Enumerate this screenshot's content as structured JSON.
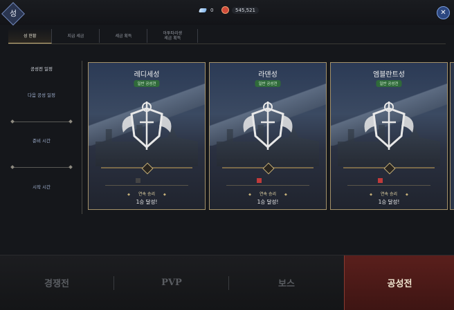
{
  "header": {
    "title": "성",
    "gems": "0",
    "gold": "545,521"
  },
  "tabs": [
    {
      "label": "성 현황"
    },
    {
      "label": "지급 세금"
    },
    {
      "label": "세금 획득"
    },
    {
      "label": "아투타리생\n세금 획득"
    }
  ],
  "side": {
    "items": [
      {
        "label": "공성전 일정"
      },
      {
        "label": "다음 공성 일정"
      },
      {
        "label": "준비 시간"
      },
      {
        "label": "시작 시간"
      }
    ]
  },
  "cards": [
    {
      "name": "레디세성",
      "tag": "일반 공성전",
      "streak": "연속 승리",
      "result": "1승 달성!"
    },
    {
      "name": "라덴성",
      "tag": "일반 공성전",
      "streak": "연속 승리",
      "result": "1승 달성!"
    },
    {
      "name": "엠블란트성",
      "tag": "일반 공성전",
      "streak": "연속 승리",
      "result": "1승 달성!"
    }
  ],
  "bottom_nav": [
    {
      "label": "경쟁전"
    },
    {
      "label": "PVP"
    },
    {
      "label": "보스"
    },
    {
      "label": "공성전"
    }
  ],
  "colors": {
    "accent_gold": "#c8b27a",
    "active_tab_red": "#5a1f1c"
  }
}
